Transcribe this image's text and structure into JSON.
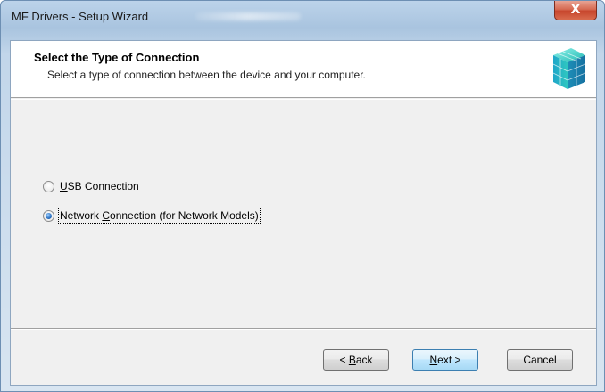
{
  "window": {
    "title": "MF Drivers - Setup Wizard",
    "close_glyph": "X"
  },
  "header": {
    "title": "Select the Type of Connection",
    "subtitle": "Select a type of connection between the device and your computer.",
    "icon": "setup-cube-icon"
  },
  "options": [
    {
      "label_prefix": "",
      "accel": "U",
      "label_rest": "SB Connection",
      "checked": false
    },
    {
      "label_prefix": "Network ",
      "accel": "C",
      "label_rest": "onnection (for Network Models)",
      "checked": true
    }
  ],
  "buttons": {
    "back": {
      "prefix": "< ",
      "accel": "B",
      "rest": "ack"
    },
    "next": {
      "prefix": "",
      "accel": "N",
      "rest": "ext >"
    },
    "cancel": "Cancel"
  },
  "colors": {
    "title_bar": "#a9c4df",
    "close_button": "#c7452c",
    "client_bg": "#f0f0f0",
    "icon_teal": "#1cb5b0"
  }
}
